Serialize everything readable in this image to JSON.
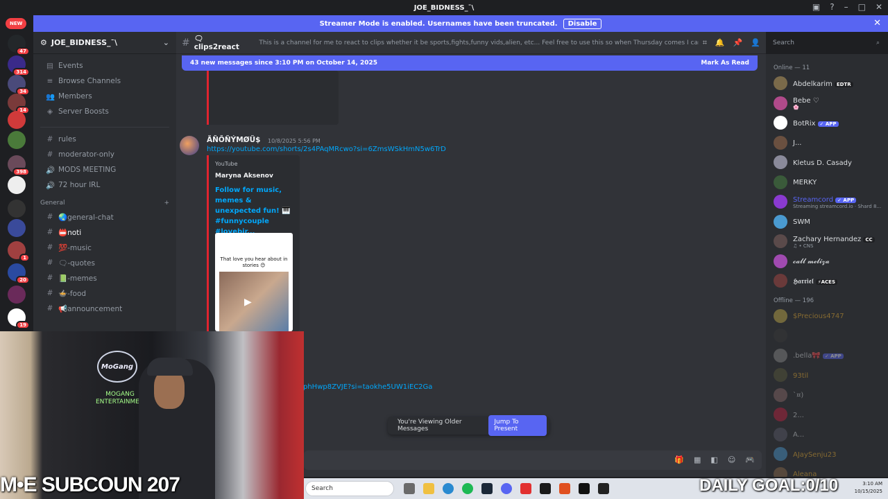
{
  "window": {
    "title": "JOE_BIDNESS_¯\\"
  },
  "streamer_bar": {
    "text": "Streamer Mode is enabled. Usernames have been truncated.",
    "button": "Disable"
  },
  "guilds": {
    "new_badge": "NEW",
    "items": [
      {
        "badge": "47"
      },
      {
        "badge": "314"
      },
      {
        "badge": "34"
      },
      {
        "badge": "14"
      },
      {
        "badge": ""
      },
      {
        "badge": ""
      },
      {
        "badge": "398"
      },
      {
        "badge": ""
      },
      {
        "badge": ""
      },
      {
        "badge": ""
      },
      {
        "badge": "1"
      },
      {
        "badge": "20"
      },
      {
        "badge": ""
      },
      {
        "badge": "19"
      }
    ]
  },
  "server": {
    "name": "JOE_BIDNESS_¯\\"
  },
  "nav": {
    "events": "Events",
    "browse": "Browse Channels",
    "members": "Members",
    "boosts": "Server Boosts"
  },
  "channels_top": [
    {
      "icon": "#",
      "label": "rules"
    },
    {
      "icon": "#",
      "label": "moderator-only"
    },
    {
      "icon": "🔊",
      "label": "MODS MEETING"
    },
    {
      "icon": "🔊",
      "label": "72 hour IRL"
    }
  ],
  "category": {
    "name": "General"
  },
  "channels": [
    {
      "icon": "#",
      "label": "🌏general-chat"
    },
    {
      "icon": "#",
      "label": "📛noti"
    },
    {
      "icon": "#",
      "label": "💯-music"
    },
    {
      "icon": "#",
      "label": "🗨-quotes"
    },
    {
      "icon": "#",
      "label": "📗-memes"
    },
    {
      "icon": "#",
      "label": "🍲-food"
    },
    {
      "icon": "#",
      "label": "📢announcement"
    }
  ],
  "chat_header": {
    "name": "🗨clips2react",
    "topic": "This is a channel for me to react to clips whether it be sports,fights,funny vids,alien, etc... Feel free to use this so when Thursday comes I can be ready to reac..."
  },
  "search": {
    "placeholder": "Search"
  },
  "new_messages": {
    "text": "43 new messages since 3:10 PM on October 14, 2025",
    "action": "Mark As Read"
  },
  "message": {
    "author": "ÃÑÕÑÝMØÜ$",
    "timestamp": "10/8/2025 5:56 PM",
    "link": "https://youtube.com/shorts/2s4PAqMRcwo?si=6ZmsWSkHmN5w6TrD",
    "embed": {
      "provider": "YouTube",
      "author": "Maryna Aksenov",
      "title": "Follow for music, memes & unexpected fun! 🎹 #funnycouple #lovebir...",
      "thumb_caption": "That love you hear about in stories 😊"
    }
  },
  "message2": {
    "link_fragment": "phHwp8ZVJE?si=taokhe5UW1iEC2Ga"
  },
  "older": {
    "text": "You're Viewing Older Messages",
    "button": "Jump To Present"
  },
  "members": {
    "online_header": "Online — 11",
    "online": [
      {
        "name": "Abdelkarim",
        "tag": "EDTR",
        "sub": "",
        "color": "#dbdee1",
        "av": "#7a6a4a"
      },
      {
        "name": "Bebe ♡",
        "tag": "",
        "sub": "🌸",
        "color": "#dbdee1",
        "av": "#b04a8a"
      },
      {
        "name": "BotRix",
        "tag": "✓ APP",
        "sub": "",
        "color": "#dbdee1",
        "av": "#ffffff"
      },
      {
        "name": "J...",
        "tag": "",
        "sub": "",
        "color": "#dbdee1",
        "av": "#6a5040"
      },
      {
        "name": "Kletus D. Casady",
        "tag": "",
        "sub": "",
        "color": "#dbdee1",
        "av": "#8a8a9a"
      },
      {
        "name": "MERKY",
        "tag": "",
        "sub": "",
        "color": "#dbdee1",
        "av": "#3a5a3a"
      },
      {
        "name": "Streamcord",
        "tag": "✓ APP",
        "sub": "Streaming streamcord.io · Shard 8...",
        "color": "#5865f2",
        "av": "#8a3ad0"
      },
      {
        "name": "SWM",
        "tag": "",
        "sub": "",
        "color": "#dbdee1",
        "av": "#4a9ad0"
      },
      {
        "name": "Zachary Hernandez",
        "tag": "CC",
        "sub": "♫ • CNS",
        "color": "#dbdee1",
        "av": "#5a4a4a"
      },
      {
        "name": "𝓬𝓪𝓵𝓵 𝓶𝓮𝓵𝓲𝔃𝓪",
        "tag": "",
        "sub": "",
        "color": "#dbdee1",
        "av": "#a04ab0"
      },
      {
        "name": "𝕳𝖆𝖗𝖗𝖎𝖊𝖑",
        "tag": "⚡ACES",
        "sub": "",
        "color": "#dbdee1",
        "av": "#6a3a3a"
      }
    ],
    "offline_header": "Offline — 196",
    "offline": [
      {
        "name": "$Precious4747",
        "tag": "",
        "color": "#f0b232",
        "av": "#c8b04a"
      },
      {
        "name": "",
        "tag": "",
        "color": "#dbdee1",
        "av": "#3a3a3a"
      },
      {
        "name": ".bella🎀",
        "tag": "✓ APP",
        "color": "#dbdee1",
        "av": "#8a8a8a"
      },
      {
        "name": "93til",
        "tag": "",
        "color": "#f0b232",
        "av": "#5a5a3a"
      },
      {
        "name": "`¤)",
        "tag": "",
        "color": "#dbdee1",
        "av": "#8a6a6a"
      },
      {
        "name": "2...",
        "tag": "",
        "color": "#dbdee1",
        "av": "#c02040"
      },
      {
        "name": "A...",
        "tag": "",
        "color": "#dbdee1",
        "av": "#5a5a6a"
      },
      {
        "name": "AJaySenju23",
        "tag": "",
        "color": "#f0b232",
        "av": "#4a9ad0"
      },
      {
        "name": "Aleana",
        "tag": "",
        "color": "#f0b232",
        "av": "#8a6a4a"
      }
    ]
  },
  "overlay": {
    "subcount": "M•E SUBCOUN 207",
    "goal": "DAILY GOAL:0/10",
    "webcam_logo": "MoGang",
    "webcam_text": "MOGANG ENTERTAINMENT"
  },
  "taskbar": {
    "search": "Search",
    "clock_time": "3:10 AM",
    "clock_date": "10/15/2025"
  },
  "colors": {
    "blurple": "#5865f2",
    "red_accent": "#e0242f",
    "link": "#00a8fc"
  }
}
